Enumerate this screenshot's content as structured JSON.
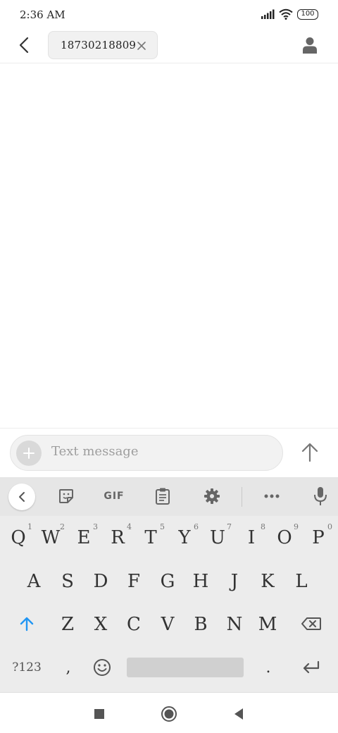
{
  "status_bar": {
    "time": "2:36 AM",
    "battery": "100",
    "icons": [
      "signal-icon",
      "wifi-icon",
      "battery-icon"
    ]
  },
  "header": {
    "back_icon": "chevron-left-icon",
    "recipient": "18730218809",
    "chip_close_icon": "close-icon",
    "contact_icon": "person-icon"
  },
  "composer": {
    "placeholder": "Text message",
    "attach_icon": "plus-icon",
    "send_icon": "arrow-up-icon"
  },
  "keyboard": {
    "toolbar_icons": [
      "chevron-left-icon",
      "sticker-icon",
      "gif-icon",
      "clipboard-icon",
      "gear-icon",
      "more-icon",
      "microphone-icon"
    ],
    "gif_label": "GIF",
    "row1": [
      {
        "label": "Q",
        "hint": "1"
      },
      {
        "label": "W",
        "hint": "2"
      },
      {
        "label": "E",
        "hint": "3"
      },
      {
        "label": "R",
        "hint": "4"
      },
      {
        "label": "T",
        "hint": "5"
      },
      {
        "label": "Y",
        "hint": "6"
      },
      {
        "label": "U",
        "hint": "7"
      },
      {
        "label": "I",
        "hint": "8"
      },
      {
        "label": "O",
        "hint": "9"
      },
      {
        "label": "P",
        "hint": "0"
      }
    ],
    "row2": [
      "A",
      "S",
      "D",
      "F",
      "G",
      "H",
      "J",
      "K",
      "L"
    ],
    "row3": [
      "Z",
      "X",
      "C",
      "V",
      "B",
      "N",
      "M"
    ],
    "symbols_label": "?123",
    "comma_label": ",",
    "period_label": ".",
    "shift_icon": "shift-arrow-icon",
    "backspace_icon": "backspace-icon",
    "emoji_icon": "emoji-icon",
    "enter_icon": "enter-icon"
  },
  "nav_bar": {
    "icons": [
      "recents-square-icon",
      "home-circle-icon",
      "back-triangle-icon"
    ]
  },
  "colors": {
    "background": "#ffffff",
    "keyboard_bg": "#ececec",
    "accent": "#2196f3",
    "placeholder": "#9e9e9e"
  }
}
